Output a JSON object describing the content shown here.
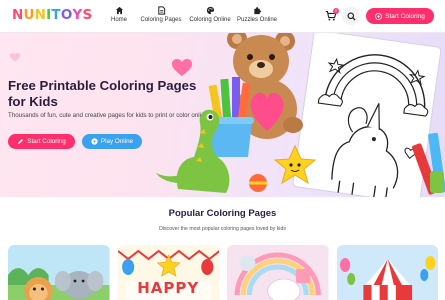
{
  "logo": {
    "letters": [
      "N",
      "U",
      "N",
      "I",
      "T",
      "O",
      "Y",
      "S"
    ],
    "colors": [
      "#ff4b6e",
      "#ff9a1f",
      "#f7c41f",
      "#4cc23f",
      "#2fa7e8",
      "#7b5cf0",
      "#e847c2",
      "#ff4b6e"
    ]
  },
  "nav": {
    "items": [
      {
        "label": "Home",
        "icon": "home-icon"
      },
      {
        "label": "Coloring Pages",
        "icon": "document-icon"
      },
      {
        "label": "Coloring Online",
        "icon": "palette-icon"
      },
      {
        "label": "Puzzles Online",
        "icon": "puzzle-icon"
      }
    ],
    "cart_count": "0",
    "start_label": "Start Coloring"
  },
  "hero": {
    "title": "Free Printable Coloring Pages for Kids",
    "subtitle": "Thousands of fun, cute and creative pages for kids to print or color online!",
    "primary_label": "Start Coloring",
    "secondary_label": "Play Online"
  },
  "section": {
    "title": "Popular Coloring Pages",
    "subtitle": "Discover the most popular coloring pages loved by kids",
    "cards": [
      {
        "name": "jungle-animals-card",
        "banner_text": ""
      },
      {
        "name": "birthday-card",
        "banner_text": "HAPPY"
      },
      {
        "name": "unicorn-rainbow-card",
        "banner_text": ""
      },
      {
        "name": "circus-card",
        "banner_text": ""
      }
    ]
  },
  "colors": {
    "accent_pink": "#ff2f6d",
    "accent_blue": "#3aa0f0",
    "title": "#2a1e3e"
  }
}
